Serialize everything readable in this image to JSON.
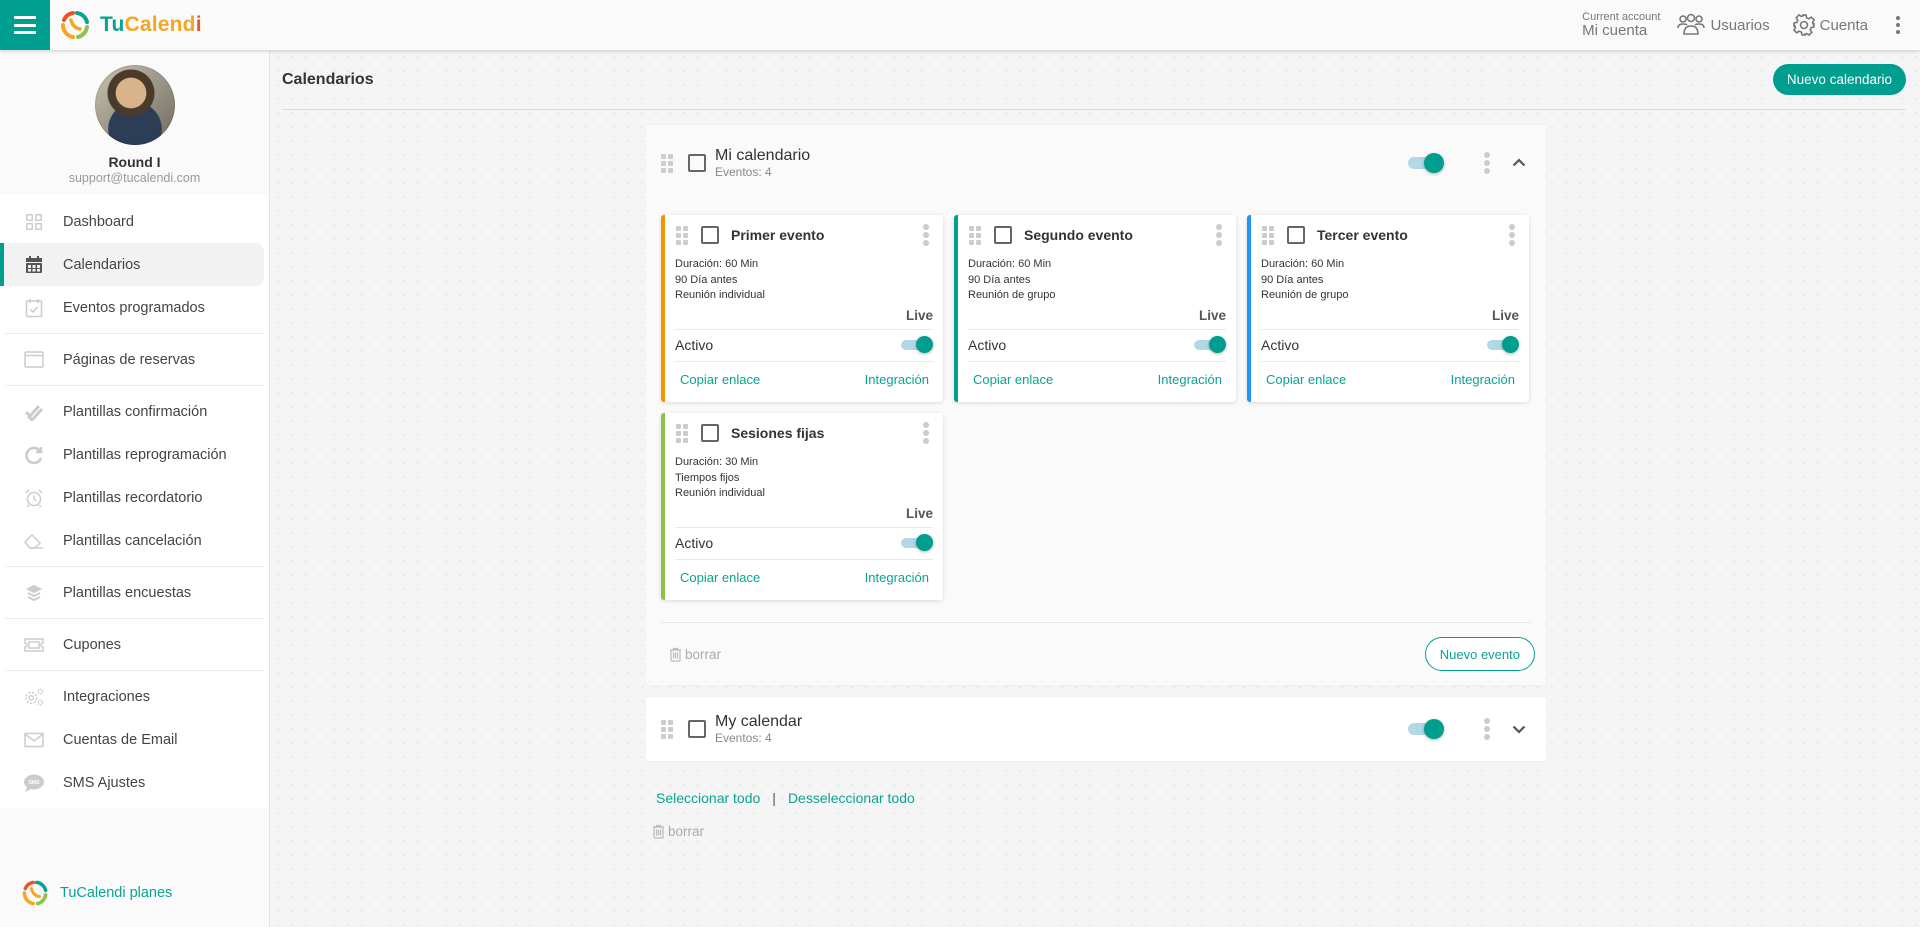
{
  "app": {
    "brand_parts": [
      "Tu",
      "Calend",
      "i"
    ],
    "menu_icon": "hamburger-icon",
    "logo_icon": "tucalendi-logo-icon"
  },
  "header": {
    "account_caption": "Current account",
    "account_name": "Mi cuenta",
    "users_label": "Usuarios",
    "users_icon": "users-icon",
    "account_label": "Cuenta",
    "account_icon": "gear-icon",
    "more_icon": "more-vertical-icon"
  },
  "profile": {
    "name": "Round I",
    "email": "support@tucalendi.com"
  },
  "sidebar": {
    "groups": [
      [
        {
          "label": "Dashboard",
          "icon": "dashboard-icon",
          "active": false
        },
        {
          "label": "Calendarios",
          "icon": "calendar-icon",
          "active": true
        },
        {
          "label": "Eventos programados",
          "icon": "calendar-check-icon",
          "active": false
        }
      ],
      [
        {
          "label": "Páginas de reservas",
          "icon": "browser-window-icon",
          "active": false
        }
      ],
      [
        {
          "label": "Plantillas confirmación",
          "icon": "double-check-icon",
          "active": false
        },
        {
          "label": "Plantillas reprogramación",
          "icon": "redo-icon",
          "active": false
        },
        {
          "label": "Plantillas recordatorio",
          "icon": "alarm-clock-icon",
          "active": false
        },
        {
          "label": "Plantillas cancelación",
          "icon": "eraser-icon",
          "active": false
        }
      ],
      [
        {
          "label": "Plantillas encuestas",
          "icon": "layers-icon",
          "active": false
        }
      ],
      [
        {
          "label": "Cupones",
          "icon": "ticket-icon",
          "active": false
        }
      ],
      [
        {
          "label": "Integraciones",
          "icon": "gears-icon",
          "active": false
        },
        {
          "label": "Cuentas de Email",
          "icon": "envelope-icon",
          "active": false
        },
        {
          "label": "SMS Ajustes",
          "icon": "sms-bubble-icon",
          "active": false
        }
      ]
    ],
    "plans_label": "TuCalendi planes"
  },
  "main": {
    "title": "Calendarios",
    "new_calendar_label": "Nuevo calendario",
    "calendars": [
      {
        "title": "Mi calendario",
        "events_count": "Eventos: 4",
        "enabled": true,
        "expanded": true,
        "events": [
          {
            "title": "Primer evento",
            "duration": "Duración: 60 Min",
            "window": "90 Día antes",
            "type": "Reunión individual",
            "status": "Live",
            "active_label": "Activo",
            "active": true,
            "copy_label": "Copiar enlace",
            "integration_label": "Integración",
            "accent": "#f59300"
          },
          {
            "title": "Segundo evento",
            "duration": "Duración: 60 Min",
            "window": "90 Día antes",
            "type": "Reunión de grupo",
            "status": "Live",
            "active_label": "Activo",
            "active": true,
            "copy_label": "Copiar enlace",
            "integration_label": "Integración",
            "accent": "#009e8f"
          },
          {
            "title": "Tercer evento",
            "duration": "Duración: 60 Min",
            "window": "90 Día antes",
            "type": "Reunión de grupo",
            "status": "Live",
            "active_label": "Activo",
            "active": true,
            "copy_label": "Copiar enlace",
            "integration_label": "Integración",
            "accent": "#2196f3"
          },
          {
            "title": "Sesiones fijas",
            "duration": "Duración: 30 Min",
            "window": "Tiempos fijos",
            "type": "Reunión individual",
            "status": "Live",
            "active_label": "Activo",
            "active": true,
            "copy_label": "Copiar enlace",
            "integration_label": "Integración",
            "accent": "#8bc34a"
          }
        ],
        "delete_label": "borrar",
        "new_event_label": "Nuevo evento"
      },
      {
        "title": "My calendar",
        "events_count": "Eventos: 4",
        "enabled": true,
        "expanded": false
      }
    ],
    "select_all_label": "Seleccionar todo",
    "separator": "|",
    "deselect_all_label": "Desseleccionar todo",
    "bulk_delete_label": "borrar"
  },
  "colors": {
    "accent": "#009e8f",
    "link": "#0aa393",
    "toggle_track": "#b2d8e6"
  }
}
